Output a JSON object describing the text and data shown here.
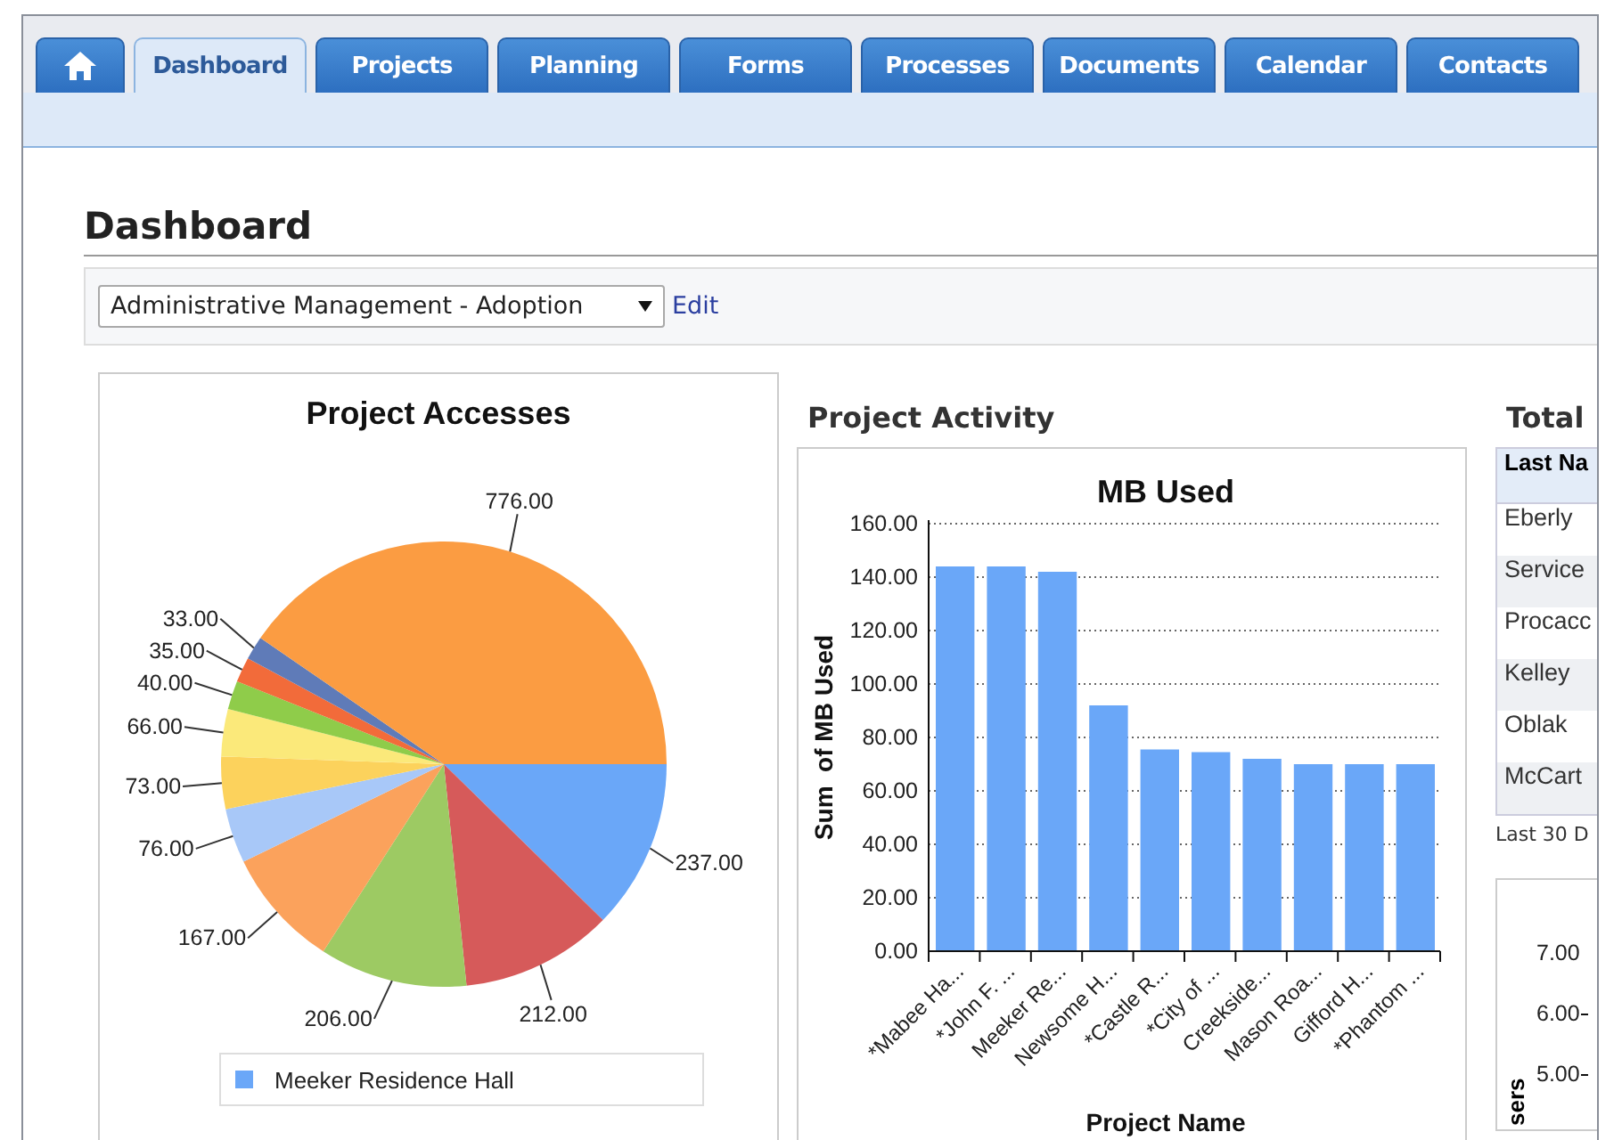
{
  "tabs": [
    {
      "kind": "home",
      "selected": false
    },
    {
      "kind": "text",
      "label": "Dashboard",
      "selected": true
    },
    {
      "kind": "text",
      "label": "Projects",
      "selected": false
    },
    {
      "kind": "text",
      "label": "Planning",
      "selected": false
    },
    {
      "kind": "text",
      "label": "Forms",
      "selected": false
    },
    {
      "kind": "text",
      "label": "Processes",
      "selected": false
    },
    {
      "kind": "text",
      "label": "Documents",
      "selected": false
    },
    {
      "kind": "text",
      "label": "Calendar",
      "selected": false
    },
    {
      "kind": "text",
      "label": "Contacts",
      "selected": false
    }
  ],
  "page_title": "Dashboard",
  "dashboard_select": {
    "value": "Administrative Management - Adoption",
    "edit_link": "Edit"
  },
  "project_accesses": {
    "chart_data": {
      "type": "pie",
      "title": "Project Accesses",
      "data_labels": true,
      "series": [
        {
          "values": [
            237,
            212,
            206,
            167,
            76,
            73,
            66,
            40,
            35,
            33,
            776
          ],
          "value_labels": [
            "237.00",
            "212.00",
            "206.00",
            "167.00",
            "76.00",
            "73.00",
            "66.00",
            "40.00",
            "35.00",
            "33.00",
            "776.00"
          ],
          "colors": [
            "#6aa7f8",
            "#d65a5a",
            "#9dca63",
            "#fba25c",
            "#a8c8f8",
            "#fcd25c",
            "#fbe97a",
            "#8fcc4a",
            "#f26b3a",
            "#5f7bb8",
            "#fb9c42"
          ]
        }
      ]
    },
    "legend": [
      {
        "label": "Meeker Residence Hall",
        "color": "#6aa7f8"
      }
    ]
  },
  "project_activity": {
    "heading": "Project Activity",
    "chart_data": {
      "type": "bar",
      "title": "MB Used",
      "xlabel": "Project Name",
      "ylabel": "Sum  of MB Used",
      "categories": [
        "*Mabee Ha...",
        "*John F. ...",
        "Meeker Re...",
        "Newsome H...",
        "*Castle R...",
        "*City of ...",
        "Creekside...",
        "Mason Roa...",
        "Gifford H...",
        "*Phantom ..."
      ],
      "grid": true,
      "series": [
        {
          "color": "#6aa7f8",
          "values": [
            144,
            144,
            142,
            92,
            75.5,
            74.5,
            72,
            70,
            70,
            70
          ]
        }
      ],
      "ylim": [
        0,
        160
      ],
      "yticks": [
        {
          "value": 0,
          "label": "0.00"
        },
        {
          "value": 20,
          "label": "20.00"
        },
        {
          "value": 40,
          "label": "40.00"
        },
        {
          "value": 60,
          "label": "60.00"
        },
        {
          "value": 80,
          "label": "80.00"
        },
        {
          "value": 100,
          "label": "100.00"
        },
        {
          "value": 120,
          "label": "120.00"
        },
        {
          "value": 140,
          "label": "140.00"
        },
        {
          "value": 160,
          "label": "160.00"
        }
      ]
    }
  },
  "total": {
    "heading": "Total",
    "table": {
      "columns": [
        "Last Na"
      ],
      "rows": [
        "Eberly",
        "Service",
        "Procacc",
        "Kelley",
        "Oblak",
        "McCart"
      ]
    },
    "note": "Last 30 D"
  },
  "users_chart": {
    "tick_labels": [
      "7.00",
      "6.00",
      "5.00"
    ],
    "axis_label": "sers"
  }
}
